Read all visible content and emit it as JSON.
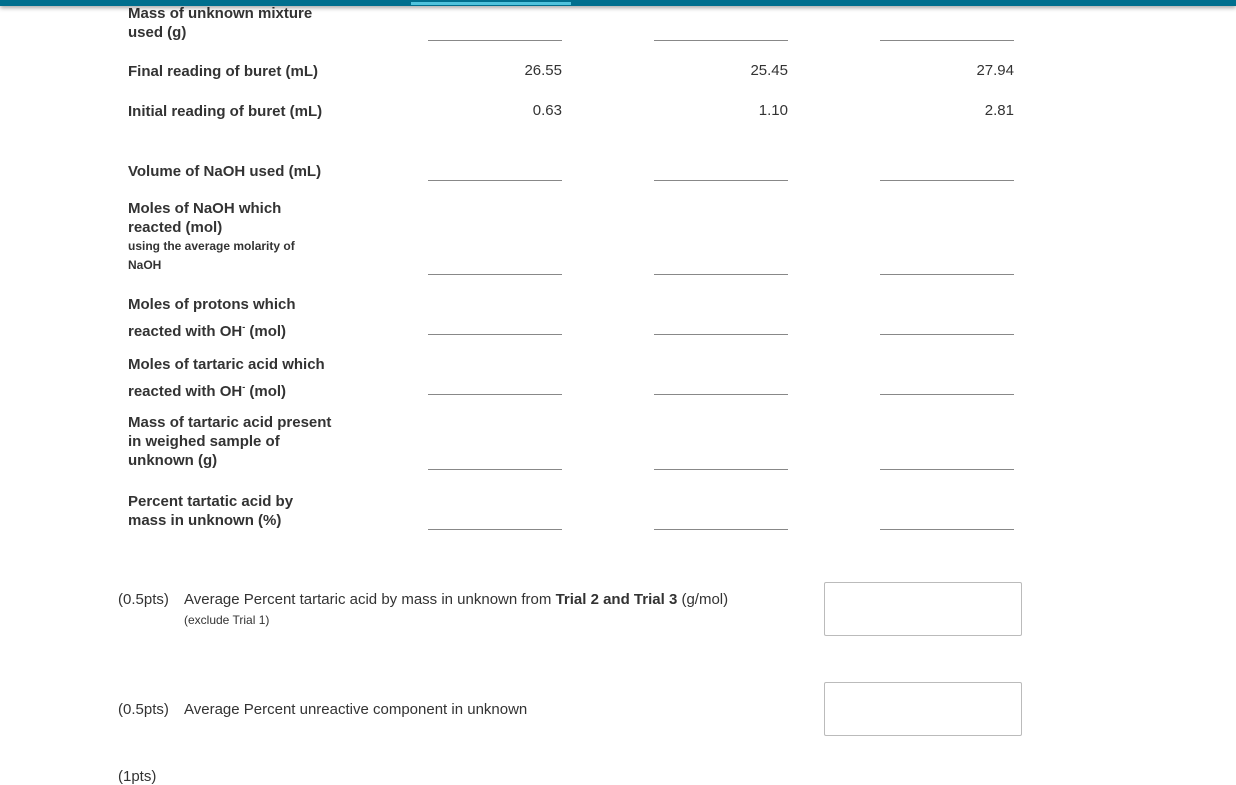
{
  "rows": [
    {
      "label": "Mass of unknown mixture used (g)"
    },
    {
      "label": "Final reading of buret (mL)",
      "values": [
        "26.55",
        "25.45",
        "27.94"
      ]
    },
    {
      "label": "Initial reading of buret (mL)",
      "values": [
        "0.63",
        "1.10",
        "2.81"
      ]
    },
    {
      "label": "Volume of NaOH used (mL)"
    },
    {
      "label": "Moles of NaOH which reacted (mol)",
      "sublabel": "using the average molarity of NaOH"
    },
    {
      "label": "Moles of protons which reacted with OH",
      "sup": "-",
      "unit": " (mol)"
    },
    {
      "label": "Moles of tartaric acid which reacted with OH",
      "sup": "-",
      "unit": " (mol)"
    },
    {
      "label": "Mass of tartaric acid present in weighed sample of unknown (g)"
    },
    {
      "label": "Percent tartatic acid by mass in unknown (%)"
    }
  ],
  "questions": [
    {
      "points": "(0.5pts)",
      "text_before": "Average Percent tartaric acid by mass in unknown from ",
      "bold": "Trial 2 and Trial 3",
      "text_after": " (g/mol)",
      "note": "(exclude Trial 1)"
    },
    {
      "points": "(0.5pts)",
      "text_before": "Average Percent unreactive component in unknown"
    },
    {
      "points": "(1pts)"
    }
  ],
  "colors": {
    "topbar": "#006f8e",
    "active_tab": "#4fc3dd"
  }
}
